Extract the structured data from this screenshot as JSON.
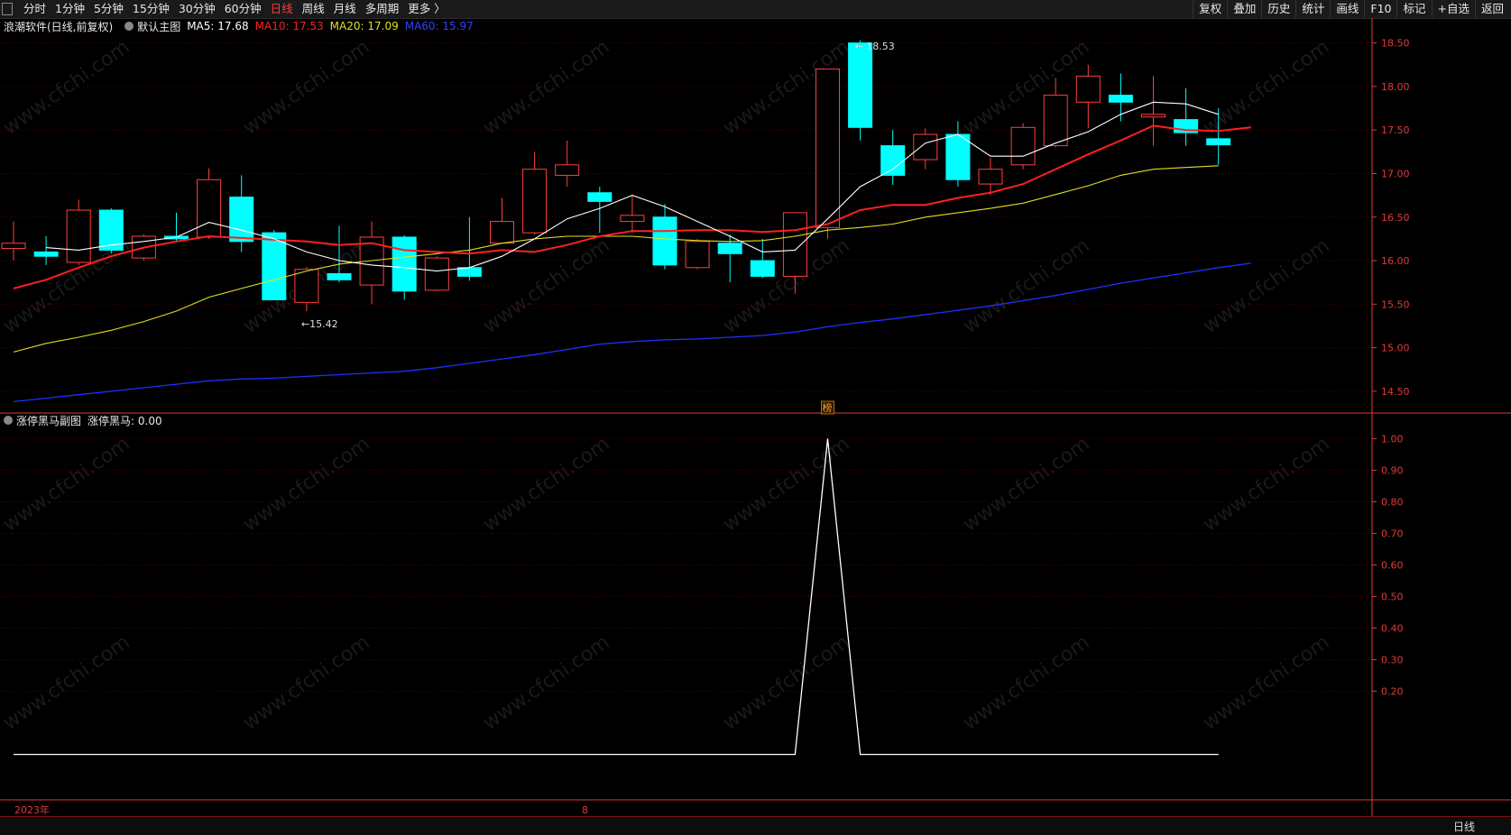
{
  "toolbar": {
    "periods": [
      "分时",
      "1分钟",
      "5分钟",
      "15分钟",
      "30分钟",
      "60分钟",
      "日线",
      "周线",
      "月线",
      "多周期",
      "更多 〉"
    ],
    "active_period": "日线",
    "tools": [
      "复权",
      "叠加",
      "历史",
      "统计",
      "画线",
      "F10",
      "标记",
      "+自选",
      "返回"
    ]
  },
  "main_legend": {
    "title": "浪潮软件(日线,前复权)",
    "indicator": "默认主图",
    "ma5": "MA5: 17.68",
    "ma10": "MA10: 17.53",
    "ma20": "MA20: 17.09",
    "ma60": "MA60: 15.97"
  },
  "sub_legend": {
    "title": "涨停黑马副图",
    "value": "涨停黑马: 0.00"
  },
  "colors": {
    "up": "#ff4040",
    "down": "#00ffff",
    "ma5": "#ffffff",
    "ma10": "#ff2020",
    "ma20": "#e0e020",
    "ma60": "#2030ff",
    "axis": "#e03a3a",
    "grid": "#5a0000"
  },
  "annotations": {
    "high": "← 18.53",
    "low": "←15.42",
    "marker": "榜"
  },
  "footer": {
    "year": "2023年",
    "month": "8",
    "period_label": "日线"
  },
  "watermark": "www.cfchi.com",
  "chart_data": [
    {
      "type": "candlestick",
      "title": "浪潮软件(日线,前复权)",
      "y_ticks": [
        18.5,
        18.0,
        17.5,
        17.0,
        16.5,
        16.0,
        15.5,
        15.0,
        14.5
      ],
      "ylim": [
        14.25,
        18.6
      ],
      "candles": [
        {
          "o": 16.14,
          "h": 16.45,
          "l": 16.0,
          "c": 16.2
        },
        {
          "o": 16.1,
          "h": 16.28,
          "l": 15.95,
          "c": 16.05
        },
        {
          "o": 15.98,
          "h": 16.7,
          "l": 15.95,
          "c": 16.58
        },
        {
          "o": 16.58,
          "h": 16.6,
          "l": 16.08,
          "c": 16.12
        },
        {
          "o": 16.03,
          "h": 16.3,
          "l": 16.0,
          "c": 16.28
        },
        {
          "o": 16.28,
          "h": 16.55,
          "l": 16.22,
          "c": 16.25
        },
        {
          "o": 16.27,
          "h": 17.06,
          "l": 16.25,
          "c": 16.93
        },
        {
          "o": 16.73,
          "h": 16.98,
          "l": 16.1,
          "c": 16.22
        },
        {
          "o": 16.32,
          "h": 16.35,
          "l": 15.55,
          "c": 15.55
        },
        {
          "o": 15.52,
          "h": 15.93,
          "l": 15.42,
          "c": 15.9
        },
        {
          "o": 15.85,
          "h": 16.4,
          "l": 15.75,
          "c": 15.78
        },
        {
          "o": 15.72,
          "h": 16.45,
          "l": 15.5,
          "c": 16.27
        },
        {
          "o": 16.27,
          "h": 16.29,
          "l": 15.55,
          "c": 15.65
        },
        {
          "o": 15.66,
          "h": 16.05,
          "l": 15.65,
          "c": 16.03
        },
        {
          "o": 15.92,
          "h": 16.5,
          "l": 15.77,
          "c": 15.82
        },
        {
          "o": 16.2,
          "h": 16.72,
          "l": 16.2,
          "c": 16.45
        },
        {
          "o": 16.32,
          "h": 17.25,
          "l": 16.3,
          "c": 17.05
        },
        {
          "o": 16.98,
          "h": 17.38,
          "l": 16.85,
          "c": 17.1
        },
        {
          "o": 16.78,
          "h": 16.85,
          "l": 16.32,
          "c": 16.68
        },
        {
          "o": 16.45,
          "h": 16.76,
          "l": 16.32,
          "c": 16.52
        },
        {
          "o": 16.5,
          "h": 16.65,
          "l": 15.9,
          "c": 15.95
        },
        {
          "o": 15.92,
          "h": 16.25,
          "l": 15.9,
          "c": 16.22
        },
        {
          "o": 16.2,
          "h": 16.3,
          "l": 15.75,
          "c": 16.08
        },
        {
          "o": 16.0,
          "h": 16.25,
          "l": 15.8,
          "c": 15.82
        },
        {
          "o": 15.82,
          "h": 16.55,
          "l": 15.62,
          "c": 16.55
        },
        {
          "o": 16.38,
          "h": 18.2,
          "l": 16.25,
          "c": 18.2
        },
        {
          "o": 18.5,
          "h": 18.53,
          "l": 17.38,
          "c": 17.53
        },
        {
          "o": 17.32,
          "h": 17.5,
          "l": 16.87,
          "c": 16.98
        },
        {
          "o": 17.16,
          "h": 17.52,
          "l": 17.05,
          "c": 17.45
        },
        {
          "o": 17.45,
          "h": 17.6,
          "l": 16.85,
          "c": 16.93
        },
        {
          "o": 16.88,
          "h": 17.18,
          "l": 16.75,
          "c": 17.05
        },
        {
          "o": 17.1,
          "h": 17.58,
          "l": 17.05,
          "c": 17.53
        },
        {
          "o": 17.32,
          "h": 18.1,
          "l": 17.3,
          "c": 17.9
        },
        {
          "o": 17.82,
          "h": 18.25,
          "l": 17.52,
          "c": 18.12
        },
        {
          "o": 17.9,
          "h": 18.15,
          "l": 17.6,
          "c": 17.82
        },
        {
          "o": 17.65,
          "h": 18.12,
          "l": 17.32,
          "c": 17.68
        },
        {
          "o": 17.62,
          "h": 17.98,
          "l": 17.32,
          "c": 17.47
        },
        {
          "o": 17.4,
          "h": 17.75,
          "l": 17.1,
          "c": 17.33
        }
      ],
      "ma5": [
        null,
        16.15,
        16.12,
        16.18,
        16.22,
        16.27,
        16.44,
        16.35,
        16.25,
        16.1,
        16.0,
        15.95,
        15.92,
        15.88,
        15.92,
        16.05,
        16.25,
        16.48,
        16.6,
        16.75,
        16.62,
        16.45,
        16.28,
        16.1,
        16.12,
        16.48,
        16.85,
        17.05,
        17.35,
        17.45,
        17.2,
        17.2,
        17.35,
        17.48,
        17.68,
        17.82,
        17.8,
        17.68
      ],
      "ma10": [
        15.68,
        15.78,
        15.92,
        16.05,
        16.15,
        16.22,
        16.28,
        16.26,
        16.24,
        16.22,
        16.18,
        16.2,
        16.12,
        16.1,
        16.08,
        16.12,
        16.1,
        16.18,
        16.28,
        16.34,
        16.34,
        16.35,
        16.35,
        16.33,
        16.35,
        16.42,
        16.58,
        16.64,
        16.64,
        16.72,
        16.78,
        16.88,
        17.05,
        17.22,
        17.38,
        17.55,
        17.5,
        17.49,
        17.53
      ],
      "ma20": [
        14.95,
        15.05,
        15.12,
        15.2,
        15.3,
        15.42,
        15.58,
        15.68,
        15.78,
        15.88,
        15.96,
        16.0,
        16.04,
        16.08,
        16.12,
        16.2,
        16.25,
        16.28,
        16.28,
        16.28,
        16.25,
        16.23,
        16.22,
        16.23,
        16.28,
        16.35,
        16.38,
        16.42,
        16.5,
        16.55,
        16.6,
        16.66,
        16.76,
        16.86,
        16.98,
        17.05,
        17.07,
        17.09
      ],
      "ma60": [
        14.38,
        14.42,
        14.46,
        14.5,
        14.54,
        14.58,
        14.62,
        14.64,
        14.65,
        14.67,
        14.69,
        14.71,
        14.73,
        14.77,
        14.82,
        14.87,
        14.92,
        14.98,
        15.04,
        15.07,
        15.09,
        15.1,
        15.12,
        15.14,
        15.18,
        15.24,
        15.29,
        15.33,
        15.38,
        15.43,
        15.48,
        15.54,
        15.6,
        15.67,
        15.74,
        15.8,
        15.86,
        15.92,
        15.97
      ]
    },
    {
      "type": "line",
      "title": "涨停黑马副图",
      "y_ticks": [
        1.0,
        0.9,
        0.8,
        0.7,
        0.6,
        0.5,
        0.4,
        0.3,
        0.2
      ],
      "ylim": [
        -0.004,
        1.03
      ],
      "values": [
        0,
        0,
        0,
        0,
        0,
        0,
        0,
        0,
        0,
        0,
        0,
        0,
        0,
        0,
        0,
        0,
        0,
        0,
        0,
        0,
        0,
        0,
        0,
        0,
        0,
        1,
        0,
        0,
        0,
        0,
        0,
        0,
        0,
        0,
        0,
        0,
        0,
        0
      ]
    }
  ]
}
